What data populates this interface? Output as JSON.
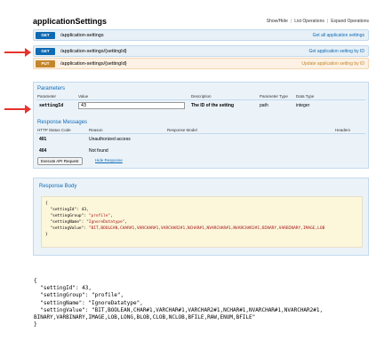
{
  "header": {
    "title": "applicationSettings",
    "links": [
      "Show/Hide",
      "List Operations",
      "Expand Operations"
    ]
  },
  "operations": [
    {
      "method": "GET",
      "path": "/application-settings",
      "desc": "Get all application settings"
    },
    {
      "method": "GET",
      "path": "/application-settings/{settingId}",
      "desc": "Get application setting by ID"
    },
    {
      "method": "PUT",
      "path": "/application-settings/{settingId}",
      "desc": "Update application setting by ID"
    }
  ],
  "parameters": {
    "title": "Parameters",
    "columns": [
      "Parameter",
      "Value",
      "Description",
      "Parameter Type",
      "Data Type"
    ],
    "row": {
      "name": "settingId",
      "value": "43",
      "description": "The ID of the setting",
      "type": "path",
      "data_type": "integer"
    }
  },
  "messages": {
    "title": "Response Messages",
    "columns": [
      "HTTP Status Code",
      "Reason",
      "Response Model",
      "Headers"
    ],
    "rows": [
      {
        "code": "401",
        "reason": "Unauthorized access"
      },
      {
        "code": "404",
        "reason": "Not found"
      }
    ]
  },
  "buttons": {
    "execute": "Execute API Request",
    "hide": "Hide Response"
  },
  "response": {
    "title": "Response Body",
    "json_lines": [
      {
        "text": "{"
      },
      {
        "key": "  \"settingId\": ",
        "value": "43",
        "tail": ","
      },
      {
        "key": "  \"settingGroup\": ",
        "value": "\"profile\"",
        "tail": ","
      },
      {
        "key": "  \"settingName\": ",
        "value": "\"IgnoreDatatype\"",
        "tail": ","
      },
      {
        "key": "  \"settingValue\": ",
        "value": "\"BIT,BOOLEAN,CHAR#1,VARCHAR#1,VARCHAR2#1,NCHAR#1,NVARCHAR#1,NVARCHAR2#1,BINARY,VARBINARY,IMAGE,LOB",
        "tail": ""
      },
      {
        "text": "}"
      }
    ]
  },
  "raw_lines": [
    "{",
    "  \"settingId\": 43,",
    "  \"settingGroup\": \"profile\",",
    "  \"settingName\": \"IgnoreDatatype\",",
    "  \"settingValue\": \"BIT,BOOLEAN,CHAR#1,VARCHAR#1,VARCHAR2#1,NCHAR#1,NVARCHAR#1,NVARCHAR2#1,",
    "BINARY,VARBINARY,IMAGE,LOB,LONG,BLOB,CLOB,NCLOB,BFILE,RAW,ENUM,BFILE\"",
    "}"
  ]
}
